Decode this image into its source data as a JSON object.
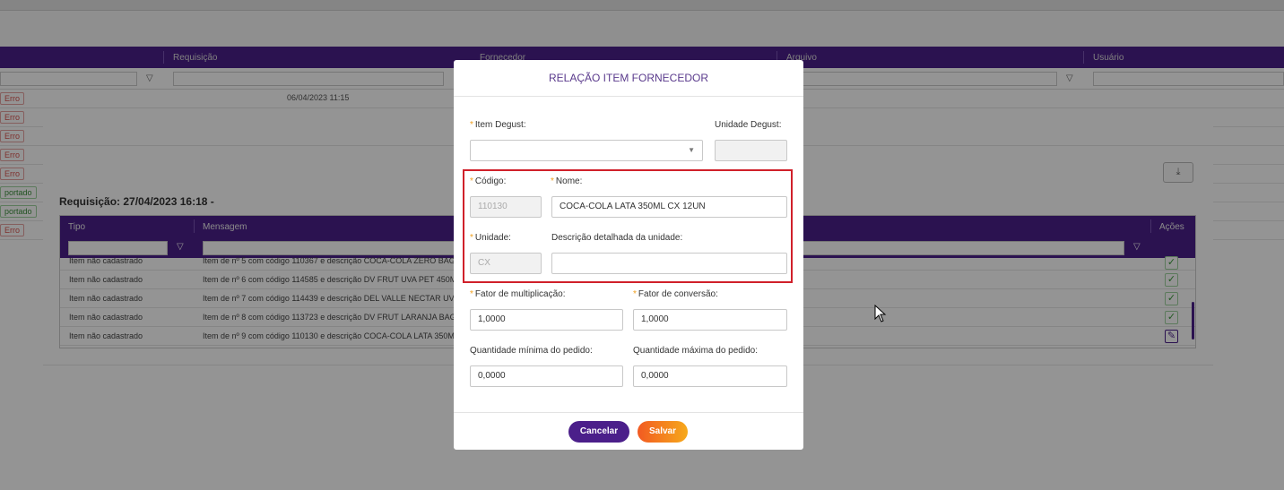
{
  "background": {
    "columns": [
      "Requisição",
      "Fornecedor",
      "Arquivo",
      "Usuário"
    ],
    "row_status": [
      "Erro",
      "Erro",
      "Erro",
      "Erro",
      "Erro",
      "portado",
      "portado",
      "Erro"
    ],
    "first_row_datetime": "06/04/2023 11:15"
  },
  "mid_modal": {
    "requisition_title": "Requisição: 27/04/2023 16:18 -",
    "columns": {
      "tipo": "Tipo",
      "mensagem": "Mensagem",
      "acoes": "Ações"
    },
    "rows": [
      {
        "tipo": "Item não cadastrado",
        "mensagem": "Item de nº 5 com código 110367 e descrição COCA-COLA ZERO BAG 5"
      },
      {
        "tipo": "Item não cadastrado",
        "mensagem": "Item de nº 6 com código 114585 e descrição DV FRUT UVA PET 450ML"
      },
      {
        "tipo": "Item não cadastrado",
        "mensagem": "Item de nº 7 com código 114439 e descrição DEL VALLE NECTAR UVA L"
      },
      {
        "tipo": "Item não cadastrado",
        "mensagem": "Item de nº 8 com código 113723 e descrição DV FRUT LARANJA BAG 5"
      },
      {
        "tipo": "Item não cadastrado",
        "mensagem": "Item de nº 9 com código 110130 e descrição COCA-COLA LATA 350ML"
      }
    ]
  },
  "modal": {
    "title": "RELAÇÃO ITEM FORNECEDOR",
    "item_degust": {
      "label": "Item Degust",
      "value": ""
    },
    "unidade_degust": {
      "label": "Unidade Degust",
      "value": ""
    },
    "codigo": {
      "label": "Código",
      "value": "110130"
    },
    "nome": {
      "label": "Nome",
      "value": "COCA-COLA LATA 350ML CX 12UN"
    },
    "unidade": {
      "label": "Unidade",
      "value": "CX"
    },
    "descricao_unidade": {
      "label": "Descrição detalhada da unidade",
      "value": ""
    },
    "fator_multiplicacao": {
      "label": "Fator de multiplicação",
      "value": "1,0000"
    },
    "fator_conversao": {
      "label": "Fator de conversão",
      "value": "1,0000"
    },
    "qtd_minima": {
      "label": "Quantidade mínima do pedido",
      "value": "0,0000"
    },
    "qtd_maxima": {
      "label": "Quantidade máxima do pedido",
      "value": "0,0000"
    },
    "cancel_label": "Cancelar",
    "save_label": "Salvar"
  },
  "colors": {
    "primary": "#4b1f8a",
    "highlight": "#d0202a",
    "save_start": "#f25a22",
    "save_end": "#f6a91b",
    "required": "#f0a020"
  }
}
